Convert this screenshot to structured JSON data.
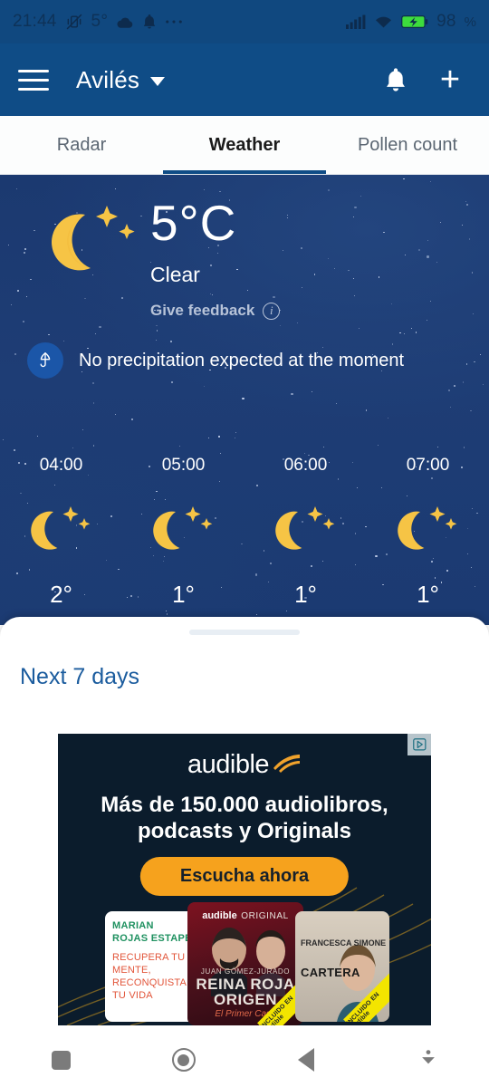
{
  "statusbar": {
    "time": "21:44",
    "vibrate_icon": "vibrate-icon",
    "temp": "5°",
    "cloud_icon": "cloud-icon",
    "bell_icon": "bell-icon",
    "more_icon": "more-dots-icon",
    "signal_icon": "cellular-signal-icon",
    "wifi_icon": "wifi-icon",
    "battery_icon": "battery-charging-icon",
    "battery_level": "98",
    "battery_unit": "%"
  },
  "appbar": {
    "menu_icon": "hamburger-menu-icon",
    "location": "Avilés",
    "caret_icon": "chevron-down-icon",
    "notifications_icon": "bell-icon",
    "add_icon": "plus-icon",
    "add_label": "+",
    "background": "#0f4c86"
  },
  "tabs": [
    {
      "label": "Radar",
      "active": false
    },
    {
      "label": "Weather",
      "active": true
    },
    {
      "label": "Pollen count",
      "active": false
    }
  ],
  "current": {
    "icon": "moon-stars-icon",
    "temperature": "5°C",
    "condition": "Clear",
    "feedback_label": "Give feedback",
    "info_icon": "info-icon",
    "info_glyph": "i"
  },
  "precipitation": {
    "icon": "umbrella-icon",
    "text": "No precipitation expected at the moment",
    "icon_background": "#1b56a8"
  },
  "hourly": [
    {
      "time": "04:00",
      "icon": "moon-stars-icon",
      "temp": "2°"
    },
    {
      "time": "05:00",
      "icon": "moon-stars-icon",
      "temp": "1°"
    },
    {
      "time": "06:00",
      "icon": "moon-stars-icon",
      "temp": "1°"
    },
    {
      "time": "07:00",
      "icon": "moon-stars-icon",
      "temp": "1°"
    }
  ],
  "sheet": {
    "drag_handle": "drag-handle",
    "next_days_label": "Next 7 days",
    "link_color": "#1b5c9e"
  },
  "ad": {
    "adchoices_icon": "adchoices-icon",
    "brand": "audible",
    "brand_logo_icon": "audible-swoosh-icon",
    "headline_line1": "Más de 150.000 audiolibros,",
    "headline_line2": "podcasts y Originals",
    "cta_label": "Escucha ahora",
    "cta_color": "#f6a21d",
    "covers": [
      {
        "author": "MARIAN ROJAS ESTAPÉ",
        "title": "RECUPERA TU MENTE, RECONQUISTA TU VIDA",
        "badge": ""
      },
      {
        "brand": "audible",
        "brand_suffix": "ORIGINAL",
        "author": "JUAN GÓMEZ-JURADO",
        "title_line1": "REINA ROJA",
        "title_line2": "ORIGEN",
        "subtitle": "El Primer Caso",
        "badge": "INCLUIDO EN audible"
      },
      {
        "author": "FRANCESCA SIMONE",
        "title": "CARTERA",
        "badge": "INCLUIDO EN audible"
      }
    ]
  },
  "navbar": {
    "recents_icon": "recents-square-icon",
    "home_icon": "home-circle-icon",
    "back_icon": "back-triangle-icon",
    "keyboard_icon": "hide-keyboard-icon"
  }
}
